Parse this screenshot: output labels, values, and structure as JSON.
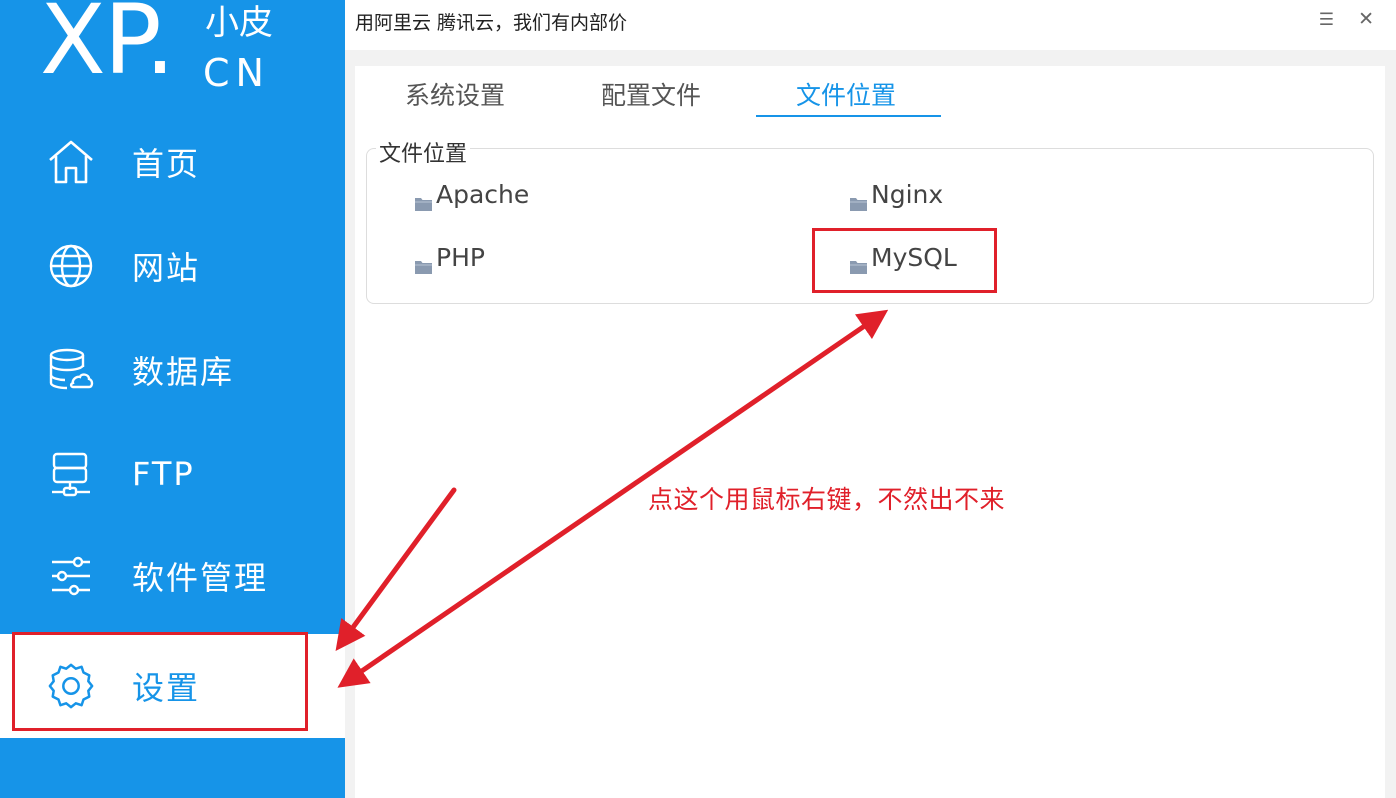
{
  "logo": {
    "brand": "XP.",
    "suffix_top": "小皮",
    "suffix_bottom": "CN"
  },
  "sidebar": {
    "items": [
      {
        "label": "首页",
        "icon": "home-icon"
      },
      {
        "label": "网站",
        "icon": "globe-icon"
      },
      {
        "label": "数据库",
        "icon": "database-icon"
      },
      {
        "label": "FTP",
        "icon": "server-icon"
      },
      {
        "label": "软件管理",
        "icon": "sliders-icon"
      },
      {
        "label": "设置",
        "icon": "gear-icon",
        "active": true
      }
    ]
  },
  "window": {
    "title": "用阿里云 腾讯云，我们有内部价",
    "menu_icon": "☰",
    "close_icon": "✕"
  },
  "tabs": [
    {
      "label": "系统设置"
    },
    {
      "label": "配置文件"
    },
    {
      "label": "文件位置",
      "active": true
    }
  ],
  "group": {
    "title": "文件位置",
    "items": [
      {
        "label": "Apache",
        "icon": "folder-icon"
      },
      {
        "label": "Nginx",
        "icon": "folder-icon"
      },
      {
        "label": "PHP",
        "icon": "folder-icon"
      },
      {
        "label": "MySQL",
        "icon": "folder-icon"
      }
    ]
  },
  "annotation": {
    "text": "点这个用鼠标右键，不然出不来"
  },
  "colors": {
    "sidebar_bg": "#1694e8",
    "accent": "#1694e8",
    "annotation_red": "#e0202a"
  }
}
